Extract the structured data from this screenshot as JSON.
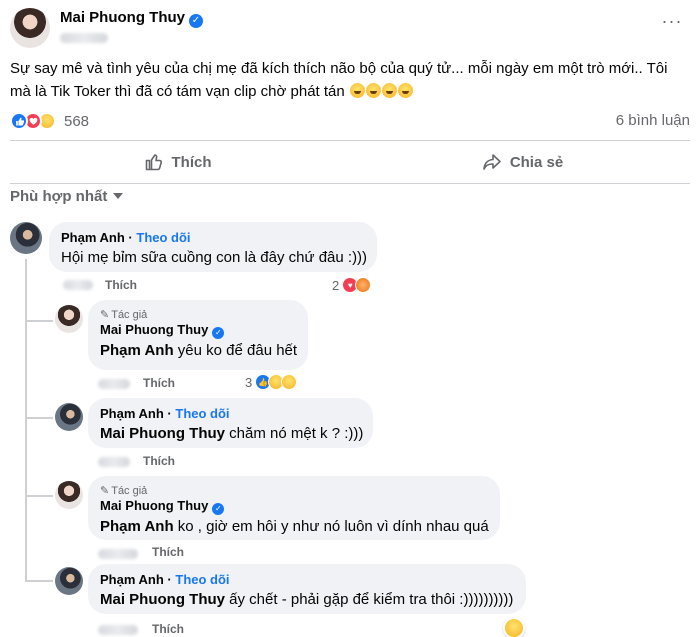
{
  "post": {
    "author": "Mai Phuong Thuy",
    "text": "Sự say mê và tình yêu của chị mẹ đã kích thích não bộ của quý tử... mỗi ngày em một trò mới.. Tôi mà là Tik Toker thì đã có tám vạn clip chờ phát tán",
    "reaction_count": "568",
    "comment_count": "6 bình luận",
    "more_icon": "···"
  },
  "actions": {
    "like": "Thích",
    "share": "Chia sẻ"
  },
  "filter": {
    "label": "Phù hợp nhất"
  },
  "comments": [
    {
      "author": "Phạm Anh",
      "follow": "Theo dõi",
      "text": "Hội mẹ bỉm sữa cuồng con là đây chứ đâu :)))",
      "like": "Thích",
      "reaction_count": "2"
    },
    {
      "author_tag": "Tác giả",
      "author": "Mai Phuong Thuy",
      "mention": "Phạm Anh",
      "text": " yêu ko để đâu hết",
      "like": "Thích",
      "reaction_count": "3"
    },
    {
      "author": "Phạm Anh",
      "follow": "Theo dõi",
      "mention": "Mai Phuong Thuy",
      "text": " chăm nó mệt k ? :)))",
      "like": "Thích"
    },
    {
      "author_tag": "Tác giả",
      "author": "Mai Phuong Thuy",
      "mention": "Phạm Anh",
      "text": " ko , giờ em hôi y như nó luôn vì dính nhau quá",
      "like": "Thích"
    },
    {
      "author": "Phạm Anh",
      "follow": "Theo dõi",
      "mention": "Mai Phuong Thuy",
      "text": " ấy chết - phải gặp để kiểm tra thôi :))))))))))",
      "like": "Thích"
    }
  ],
  "colors": {
    "accent": "#1877f2",
    "muted": "#65676b",
    "bubble": "#f0f2f5",
    "divider": "#ced0d4"
  }
}
